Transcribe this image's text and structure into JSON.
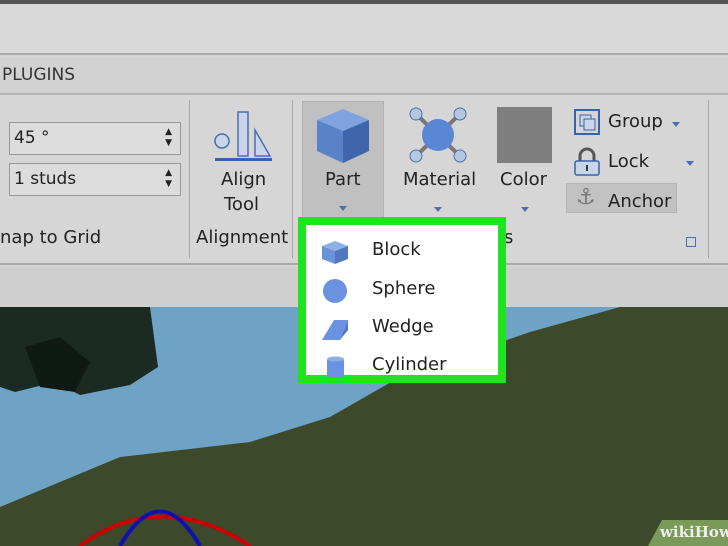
{
  "tabs": {
    "plugins": "PLUGINS"
  },
  "snap": {
    "rotate_value": "45 °",
    "move_value": "1 studs",
    "group_label": "nap to Grid"
  },
  "alignment": {
    "button_line1": "Align",
    "button_line2": "Tool",
    "group_label": "Alignment"
  },
  "part": {
    "label": "Part",
    "material": "Material",
    "color": "Color",
    "color_swatch": "#7f7f7f",
    "group_label_fragment": "s"
  },
  "grouping": {
    "group": "Group",
    "lock": "Lock",
    "anchor": "Anchor"
  },
  "part_menu": {
    "items": [
      {
        "label": "Block",
        "icon": "block-icon"
      },
      {
        "label": "Sphere",
        "icon": "sphere-icon"
      },
      {
        "label": "Wedge",
        "icon": "wedge-icon"
      },
      {
        "label": "Cylinder",
        "icon": "cylinder-icon"
      }
    ],
    "highlight_color": "#1ee31e"
  },
  "watermark": "wikiHow"
}
